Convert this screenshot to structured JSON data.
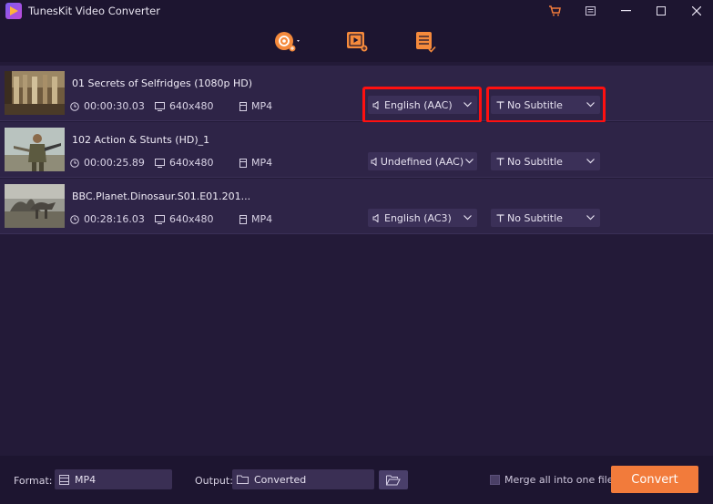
{
  "app": {
    "title": "TunesKit Video Converter"
  },
  "files": [
    {
      "name": "01 Secrets of Selfridges (1080p HD)",
      "duration": "00:00:30.03",
      "resolution": "640x480",
      "format": "MP4",
      "audio": "English (AAC)",
      "subtitle": "No Subtitle"
    },
    {
      "name": "102 Action & Stunts (HD)_1",
      "duration": "00:00:25.89",
      "resolution": "640x480",
      "format": "MP4",
      "audio": "Undefined (AAC)",
      "subtitle": "No Subtitle"
    },
    {
      "name": "BBC.Planet.Dinosaur.S01.E01.201...",
      "duration": "00:28:16.03",
      "resolution": "640x480",
      "format": "MP4",
      "audio": "English (AC3)",
      "subtitle": "No Subtitle"
    }
  ],
  "bottom": {
    "format_label": "Format:",
    "format_value": "MP4",
    "output_label": "Output:",
    "output_value": "Converted",
    "merge_label": "Merge all into one file",
    "convert_label": "Convert"
  },
  "colors": {
    "accent": "#f27b3b",
    "highlight": "#ff1010",
    "background": "#231a38",
    "row": "#2e2447"
  }
}
